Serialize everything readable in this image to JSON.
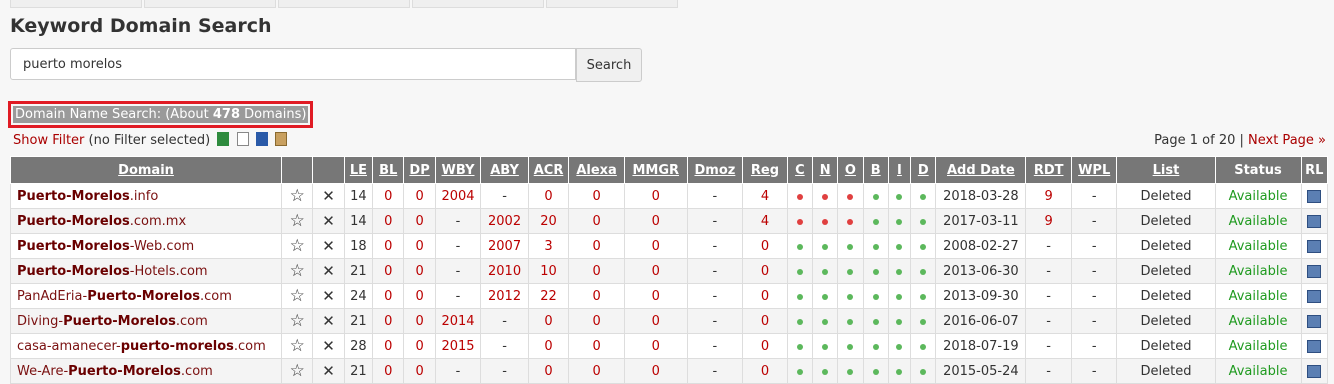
{
  "title": "Keyword Domain Search",
  "search": {
    "value": "puerto morelos",
    "button": "Search"
  },
  "summary": {
    "prefix": "Domain Name Search: (About ",
    "count": "478",
    "suffix": " Domains)"
  },
  "filter": {
    "link": "Show Filter",
    "note": "(no Filter selected)"
  },
  "pager": {
    "text": "Page 1 of 20 | ",
    "next": "Next Page »"
  },
  "columns": [
    "Domain",
    "",
    "",
    "LE",
    "BL",
    "DP",
    "WBY",
    "ABY",
    "ACR",
    "Alexa",
    "MMGR",
    "Dmoz",
    "Reg",
    "C",
    "N",
    "O",
    "B",
    "I",
    "D",
    "Add Date",
    "RDT",
    "WPL",
    "List",
    "Status",
    "RL"
  ],
  "rows": [
    {
      "pre": "",
      "bold": "Puerto-Morelos",
      "post": ".info",
      "le": "14",
      "bl": "0",
      "dp": "0",
      "wby": "2004",
      "aby": "-",
      "acr": "0",
      "alexa": "0",
      "mmgr": "0",
      "dmoz": "-",
      "reg": "4",
      "c": "r",
      "n": "r",
      "o": "r",
      "b": "g",
      "i": "g",
      "d": "g",
      "date": "2018-03-28",
      "rdt": "9",
      "wpl": "-",
      "list": "Deleted",
      "status": "Available"
    },
    {
      "pre": "",
      "bold": "Puerto-Morelos",
      "post": ".com.mx",
      "le": "14",
      "bl": "0",
      "dp": "0",
      "wby": "-",
      "aby": "2002",
      "acr": "20",
      "alexa": "0",
      "mmgr": "0",
      "dmoz": "-",
      "reg": "4",
      "c": "r",
      "n": "r",
      "o": "r",
      "b": "g",
      "i": "g",
      "d": "g",
      "date": "2017-03-11",
      "rdt": "9",
      "wpl": "-",
      "list": "Deleted",
      "status": "Available"
    },
    {
      "pre": "",
      "bold": "Puerto-Morelos",
      "post": "-Web.com",
      "le": "18",
      "bl": "0",
      "dp": "0",
      "wby": "-",
      "aby": "2007",
      "acr": "3",
      "alexa": "0",
      "mmgr": "0",
      "dmoz": "-",
      "reg": "0",
      "c": "g",
      "n": "g",
      "o": "g",
      "b": "g",
      "i": "g",
      "d": "g",
      "date": "2008-02-27",
      "rdt": "-",
      "wpl": "-",
      "list": "Deleted",
      "status": "Available"
    },
    {
      "pre": "",
      "bold": "Puerto-Morelos",
      "post": "-Hotels.com",
      "le": "21",
      "bl": "0",
      "dp": "0",
      "wby": "-",
      "aby": "2010",
      "acr": "10",
      "alexa": "0",
      "mmgr": "0",
      "dmoz": "-",
      "reg": "0",
      "c": "g",
      "n": "g",
      "o": "g",
      "b": "g",
      "i": "g",
      "d": "g",
      "date": "2013-06-30",
      "rdt": "-",
      "wpl": "-",
      "list": "Deleted",
      "status": "Available"
    },
    {
      "pre": "PanAdEria-",
      "bold": "Puerto-Morelos",
      "post": ".com",
      "le": "24",
      "bl": "0",
      "dp": "0",
      "wby": "-",
      "aby": "2012",
      "acr": "22",
      "alexa": "0",
      "mmgr": "0",
      "dmoz": "-",
      "reg": "0",
      "c": "g",
      "n": "g",
      "o": "g",
      "b": "g",
      "i": "g",
      "d": "g",
      "date": "2013-09-30",
      "rdt": "-",
      "wpl": "-",
      "list": "Deleted",
      "status": "Available"
    },
    {
      "pre": "Diving-",
      "bold": "Puerto-Morelos",
      "post": ".com",
      "le": "21",
      "bl": "0",
      "dp": "0",
      "wby": "2014",
      "aby": "-",
      "acr": "0",
      "alexa": "0",
      "mmgr": "0",
      "dmoz": "-",
      "reg": "0",
      "c": "g",
      "n": "g",
      "o": "g",
      "b": "g",
      "i": "g",
      "d": "g",
      "date": "2016-06-07",
      "rdt": "-",
      "wpl": "-",
      "list": "Deleted",
      "status": "Available"
    },
    {
      "pre": "casa-amanecer-",
      "bold": "puerto-morelos",
      "post": ".com",
      "le": "28",
      "bl": "0",
      "dp": "0",
      "wby": "2015",
      "aby": "-",
      "acr": "0",
      "alexa": "0",
      "mmgr": "0",
      "dmoz": "-",
      "reg": "0",
      "c": "g",
      "n": "g",
      "o": "g",
      "b": "g",
      "i": "g",
      "d": "g",
      "date": "2018-07-19",
      "rdt": "-",
      "wpl": "-",
      "list": "Deleted",
      "status": "Available"
    },
    {
      "pre": "We-Are-",
      "bold": "Puerto-Morelos",
      "post": ".com",
      "le": "21",
      "bl": "0",
      "dp": "0",
      "wby": "-",
      "aby": "-",
      "acr": "0",
      "alexa": "0",
      "mmgr": "0",
      "dmoz": "-",
      "reg": "0",
      "c": "g",
      "n": "g",
      "o": "g",
      "b": "g",
      "i": "g",
      "d": "g",
      "date": "2015-05-24",
      "rdt": "-",
      "wpl": "-",
      "list": "Deleted",
      "status": "Available"
    }
  ]
}
